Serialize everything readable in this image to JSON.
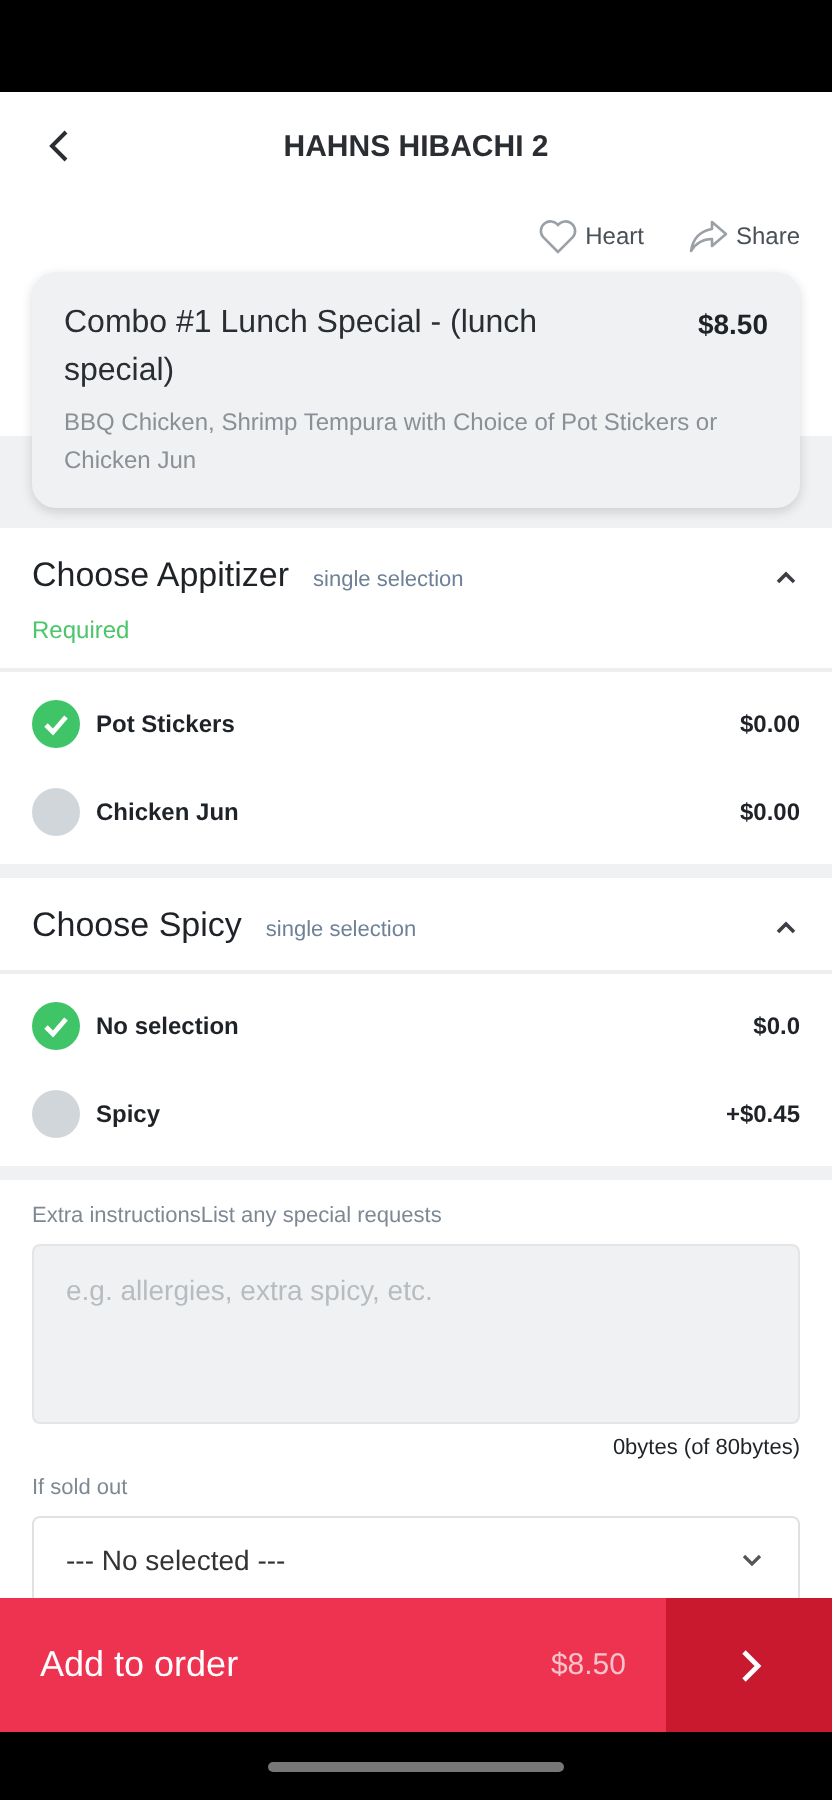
{
  "header": {
    "title": "HAHNS HIBACHI 2"
  },
  "actions": [
    {
      "kind": "heart",
      "label": "Heart"
    },
    {
      "kind": "share",
      "label": "Share"
    }
  ],
  "item": {
    "name": "Combo #1 Lunch Special - (lunch special)",
    "price": "$8.50",
    "description": "BBQ Chicken, Shrimp Tempura with Choice of Pot Stickers or Chicken Jun"
  },
  "groups": [
    {
      "title": "Choose Appitizer",
      "mode": "single selection",
      "note": "Required",
      "expanded": true,
      "options": [
        {
          "label": "Pot Stickers",
          "price": "$0.00",
          "selected": true
        },
        {
          "label": "Chicken Jun",
          "price": "$0.00",
          "selected": false
        }
      ]
    },
    {
      "title": "Choose Spicy",
      "mode": "single selection",
      "expanded": true,
      "options": [
        {
          "label": "No selection",
          "price": "$0.0",
          "selected": true
        },
        {
          "label": "Spicy",
          "price": "+$0.45",
          "selected": false
        }
      ]
    }
  ],
  "instructions": {
    "label": "Extra instructionsList any special requests",
    "placeholder": "e.g. allergies, extra spicy, etc.",
    "counter": "0bytes (of 80bytes)"
  },
  "sold_out": {
    "label": "If sold out",
    "value": "--- No selected ---"
  },
  "footer": {
    "label": "Add to order",
    "price": "$8.50"
  }
}
